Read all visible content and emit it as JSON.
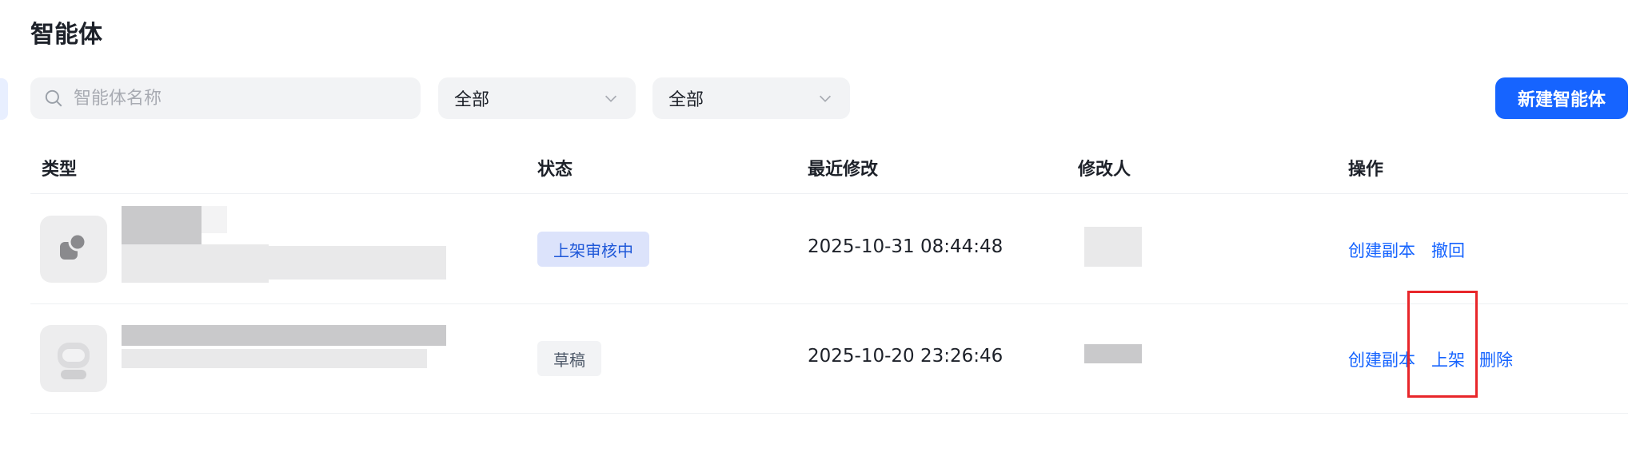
{
  "page": {
    "title": "智能体"
  },
  "search": {
    "placeholder": "智能体名称"
  },
  "filters": {
    "type_value": "全部",
    "status_value": "全部"
  },
  "toolbar": {
    "new_button_label": "新建智能体"
  },
  "table": {
    "columns": [
      "类型",
      "状态",
      "最近修改",
      "修改人",
      "操作"
    ],
    "rows": [
      {
        "status": "上架审核中",
        "modified": "2025-10-31 08:44:48",
        "actions": [
          "创建副本",
          "撤回"
        ]
      },
      {
        "status": "草稿",
        "modified": "2025-10-20 23:26:46",
        "actions": [
          "创建副本",
          "上架",
          "删除"
        ]
      }
    ]
  },
  "colors": {
    "primary": "#1664ff",
    "review_badge_bg": "#dce3fb",
    "draft_badge_bg": "#f2f3f5",
    "highlight": "#e8262a"
  },
  "icons": [
    "search-icon",
    "chevron-down-icon",
    "shapes-icon",
    "robot-icon"
  ]
}
